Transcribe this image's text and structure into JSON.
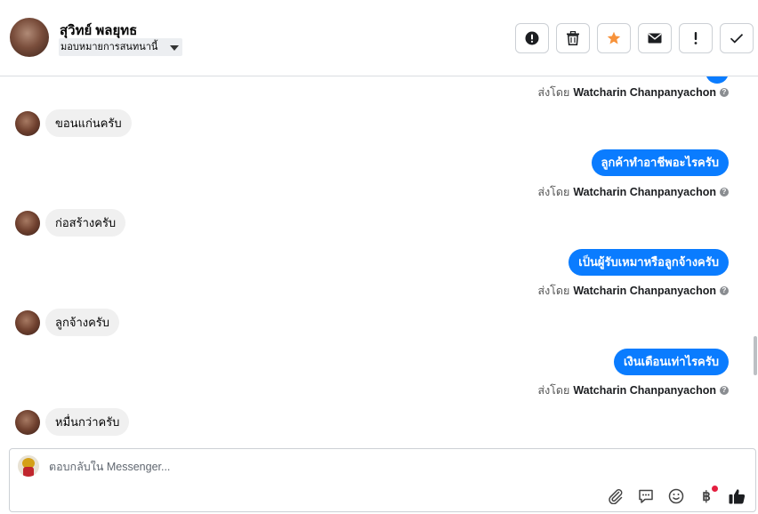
{
  "contact": {
    "name": "สุวิทย์ พลยุทธ",
    "assign_label": "มอบหมายการสนทนานี้"
  },
  "actions": [
    {
      "name": "spam-button",
      "icon": "alert-circle-icon"
    },
    {
      "name": "delete-button",
      "icon": "trash-icon"
    },
    {
      "name": "star-button",
      "icon": "star-icon",
      "color": "#f7923a"
    },
    {
      "name": "mark-unread-button",
      "icon": "envelope-icon"
    },
    {
      "name": "follow-up-button",
      "icon": "exclamation-icon"
    },
    {
      "name": "mark-done-button",
      "icon": "checkmark-icon"
    }
  ],
  "sent_by_prefix": "ส่งโดย",
  "sender_name": "Watcharin Chanpanyachon",
  "messages": [
    {
      "dir": "out",
      "text": "ลูกค้าทำอาชีพอะไรครับ"
    },
    {
      "dir": "in",
      "text": "ขอนแก่นครับ"
    },
    {
      "dir": "in",
      "text": "ก่อสร้างครับ"
    },
    {
      "dir": "out",
      "text": "เป็นผู้รับเหมาหรือลูกจ้างครับ"
    },
    {
      "dir": "in",
      "text": "ลูกจ้างครับ"
    },
    {
      "dir": "out",
      "text": "เงินเดือนเท่าไรครับ"
    },
    {
      "dir": "in",
      "text": "หมื่นกว่าครับ"
    }
  ],
  "composer": {
    "placeholder": "ตอบกลับใน Messenger...",
    "tools": [
      "paperclip-icon",
      "chat-bubble-icon",
      "emoji-icon",
      "baht-icon",
      "thumbs-up-icon"
    ],
    "baht_symbol": "฿"
  },
  "colors": {
    "outgoing_bubble": "#0a7cff",
    "incoming_bubble": "#f0f0f0",
    "accent_star": "#f7923a"
  }
}
